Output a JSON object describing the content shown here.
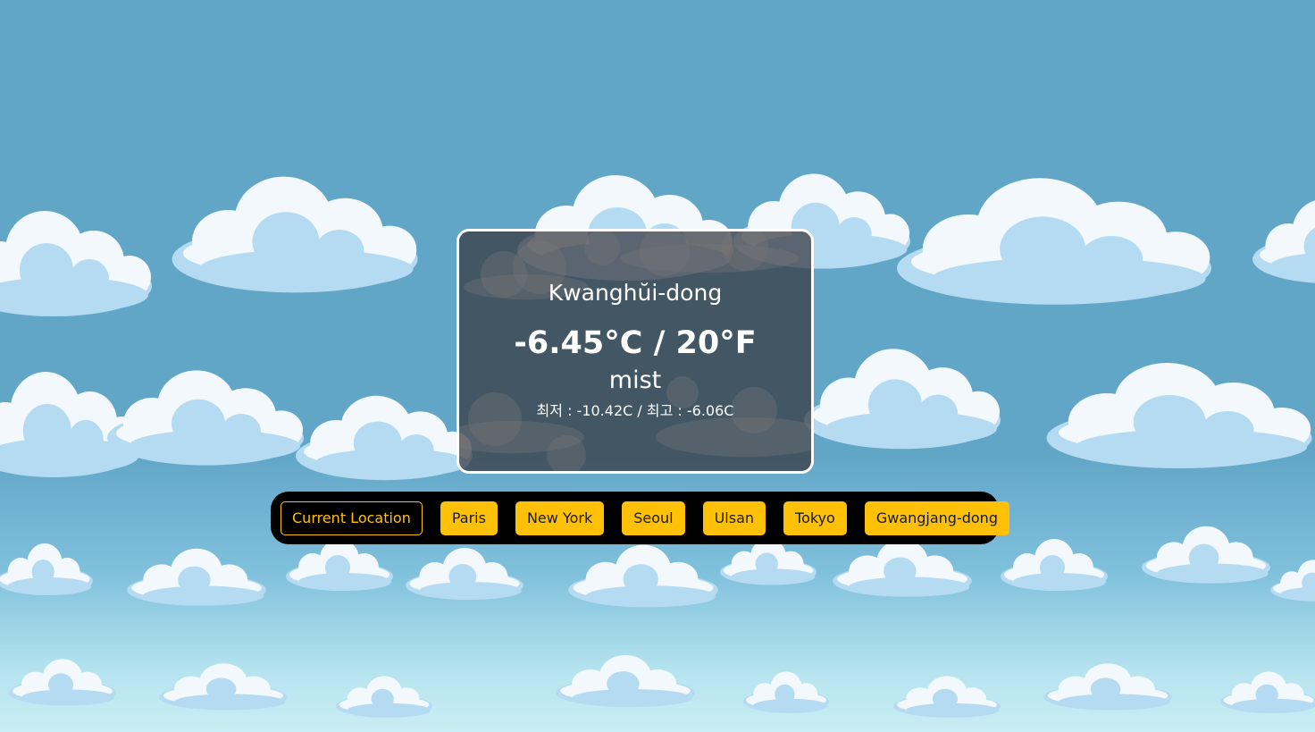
{
  "weather": {
    "location": "Kwanghŭi-dong",
    "temperature": "-6.45°C / 20°F",
    "condition": "mist",
    "min_max": "최저 : -10.42C / 최고 : -6.06C"
  },
  "city_buttons": [
    {
      "label": "Current Location",
      "style": "outline"
    },
    {
      "label": "Paris",
      "style": "filled"
    },
    {
      "label": "New York",
      "style": "filled"
    },
    {
      "label": "Seoul",
      "style": "filled"
    },
    {
      "label": "Ulsan",
      "style": "filled"
    },
    {
      "label": "Tokyo",
      "style": "filled"
    },
    {
      "label": "Gwangjang-dong",
      "style": "filled"
    }
  ],
  "colors": {
    "sky": "#62a6c7",
    "cloud": "#f2f8fb",
    "cloud_shade": "#b5dbf2",
    "card_background": "rgba(55,55,62,0.72)",
    "button_accent": "#ffc107",
    "bar_background": "#000000"
  }
}
